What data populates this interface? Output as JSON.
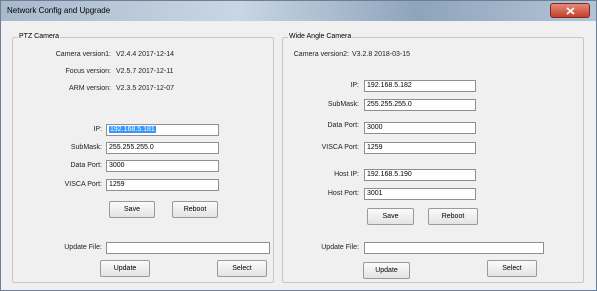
{
  "window": {
    "title": "Network Config and Upgrade"
  },
  "ptz": {
    "group_title": "PTZ Camera",
    "camera_version_label": "Camera version1:",
    "camera_version_value": "V2.4.4 2017-12-14",
    "focus_version_label": "Focus version:",
    "focus_version_value": "V2.5.7 2017-12-11",
    "arm_version_label": "ARM version:",
    "arm_version_value": "V2.3.5 2017-12-07",
    "ip_label": "IP:",
    "ip_value": "192.168.5.181",
    "submask_label": "SubMask:",
    "submask_value": "255.255.255.0",
    "data_port_label": "Data Port:",
    "data_port_value": "3000",
    "visca_port_label": "VISCA Port:",
    "visca_port_value": "1259",
    "save_label": "Save",
    "reboot_label": "Reboot",
    "update_file_label": "Update File:",
    "update_file_value": "",
    "update_label": "Update",
    "select_label": "Select"
  },
  "wide": {
    "group_title": "Wide Angle Camera",
    "camera_version_label": "Camera version2:",
    "camera_version_value": "V3.2.8 2018-03-15",
    "ip_label": "IP:",
    "ip_value": "192.168.5.182",
    "submask_label": "SubMask:",
    "submask_value": "255.255.255.0",
    "data_port_label": "Data Port:",
    "data_port_value": "3000",
    "visca_port_label": "VISCA Port:",
    "visca_port_value": "1259",
    "host_ip_label": "Host IP:",
    "host_ip_value": "192.168.5.190",
    "host_port_label": "Host Port:",
    "host_port_value": "3001",
    "save_label": "Save",
    "reboot_label": "Reboot",
    "update_file_label": "Update File:",
    "update_file_value": "",
    "update_label": "Update",
    "select_label": "Select"
  },
  "colors": {
    "selection": "#3399ff",
    "close_button": "#c7402a"
  },
  "icons": {
    "close": "close-icon"
  }
}
